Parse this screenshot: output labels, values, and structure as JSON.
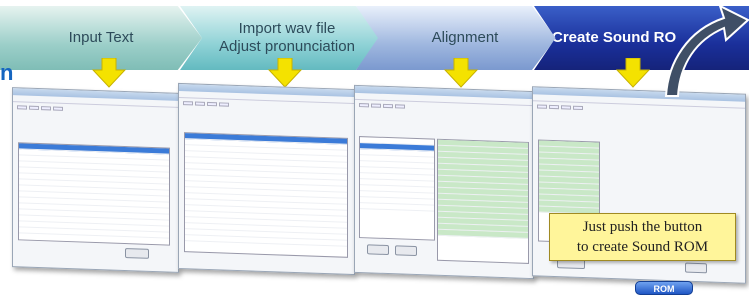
{
  "steps": [
    {
      "label_lines": [
        "Input Text"
      ]
    },
    {
      "label_lines": [
        "Import wav file",
        "Adjust pronunciation"
      ]
    },
    {
      "label_lines": [
        "Alignment"
      ]
    },
    {
      "label_lines": [
        "Create Sound RO"
      ]
    }
  ],
  "left_letter": "n",
  "callout": {
    "line1": "Just push the button",
    "line2": "to create Sound ROM"
  },
  "rom_button_label": "ROM",
  "colors": {
    "accent_blue": "#1a2f9a",
    "arrow_yellow": "#f4e200",
    "callout_yellow": "#fff59a"
  }
}
